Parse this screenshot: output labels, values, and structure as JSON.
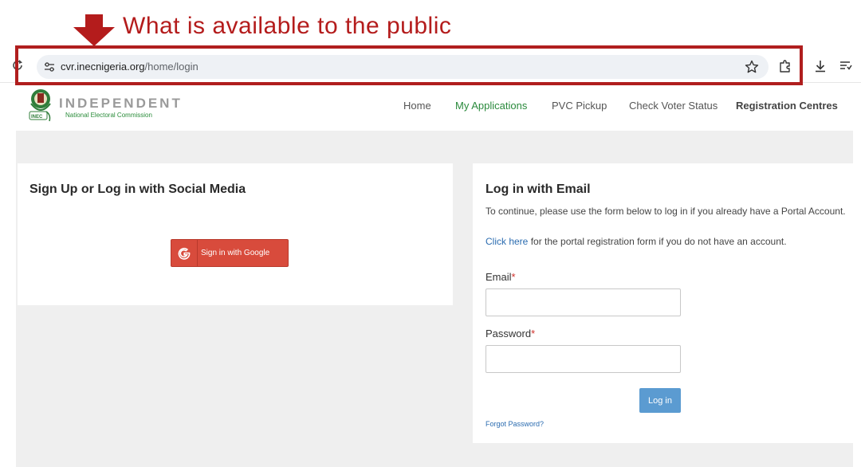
{
  "annotation": {
    "text": "What is available to the public",
    "color": "#b41c1c"
  },
  "browser": {
    "url_host": "cvr.inecnigeria.org",
    "url_path": "/home/login",
    "icons": [
      "reload-icon",
      "site-info-icon",
      "bookmark-star-icon",
      "extensions-icon",
      "download-icon",
      "reading-list-icon"
    ]
  },
  "header": {
    "logo_title": "INDEPENDENT",
    "logo_subtitle": "National Electoral Commission",
    "nav": [
      {
        "label": "Home"
      },
      {
        "label": "My Applications"
      },
      {
        "label": "PVC Pickup"
      },
      {
        "label": "Check Voter Status"
      },
      {
        "label": "Registration Centres"
      }
    ]
  },
  "social_card": {
    "title": "Sign Up or Log in with Social Media",
    "google_button": "Sign in with Google"
  },
  "email_card": {
    "title": "Log in with Email",
    "intro": "To continue, please use the form below to log in if you already have a Portal Account.",
    "register_link": "Click here",
    "register_rest": " for the portal registration form if you do not have an account.",
    "email_label": "Email",
    "password_label": "Password",
    "required_mark": "*",
    "email_value": "",
    "password_value": "",
    "login_button": "Log in",
    "forgot_password": "Forgot Password?"
  },
  "colors": {
    "accent_red": "#b01e1e",
    "google_red": "#d84b3c",
    "login_blue": "#5b9bd1",
    "nav_green": "#2a8a3c"
  }
}
